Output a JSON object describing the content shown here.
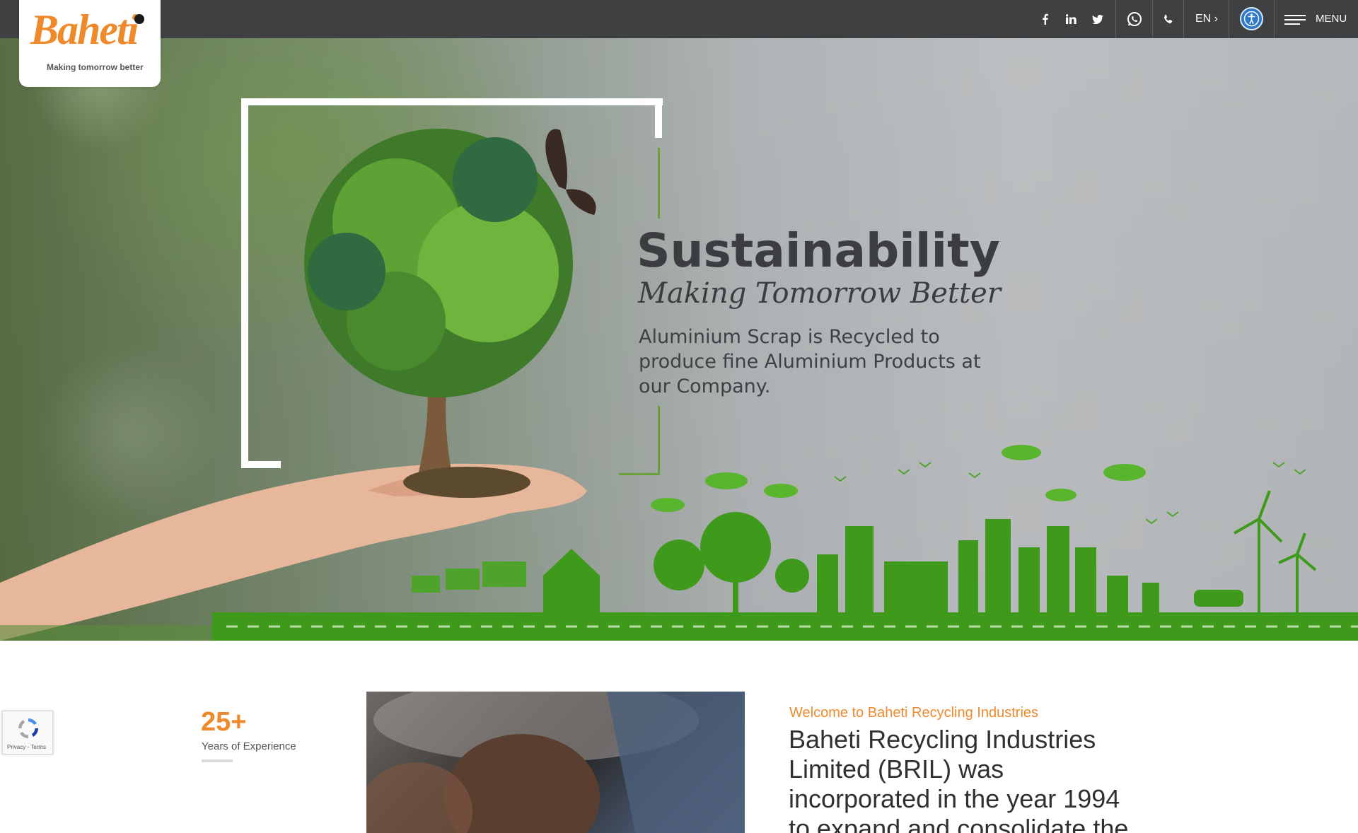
{
  "header": {
    "logo_text": "Baheti",
    "logo_tagline": "Making tomorrow better",
    "language": "EN ›",
    "menu_label": "MENU",
    "social_icons": [
      "facebook-icon",
      "linkedin-icon",
      "twitter-icon",
      "whatsapp-icon",
      "phone-icon"
    ]
  },
  "hero": {
    "title": "Sustainability",
    "subtitle": "Making Tomorrow Better",
    "description": "Aluminium Scrap is Recycled to produce fine Aluminium Products at our Company."
  },
  "stats": {
    "years_value": "25+",
    "years_label": "Years of Experience"
  },
  "about": {
    "welcome": "Welcome to Baheti Recycling Industries",
    "intro": "Baheti Recycling Industries Limited (BRIL) was incorporated in the year 1994 to expand and consolidate the"
  },
  "recaptcha": {
    "terms": "Privacy - Terms"
  },
  "colors": {
    "accent": "#ee8a2b",
    "topbar": "#3f4042",
    "green": "#3f9a1c"
  }
}
